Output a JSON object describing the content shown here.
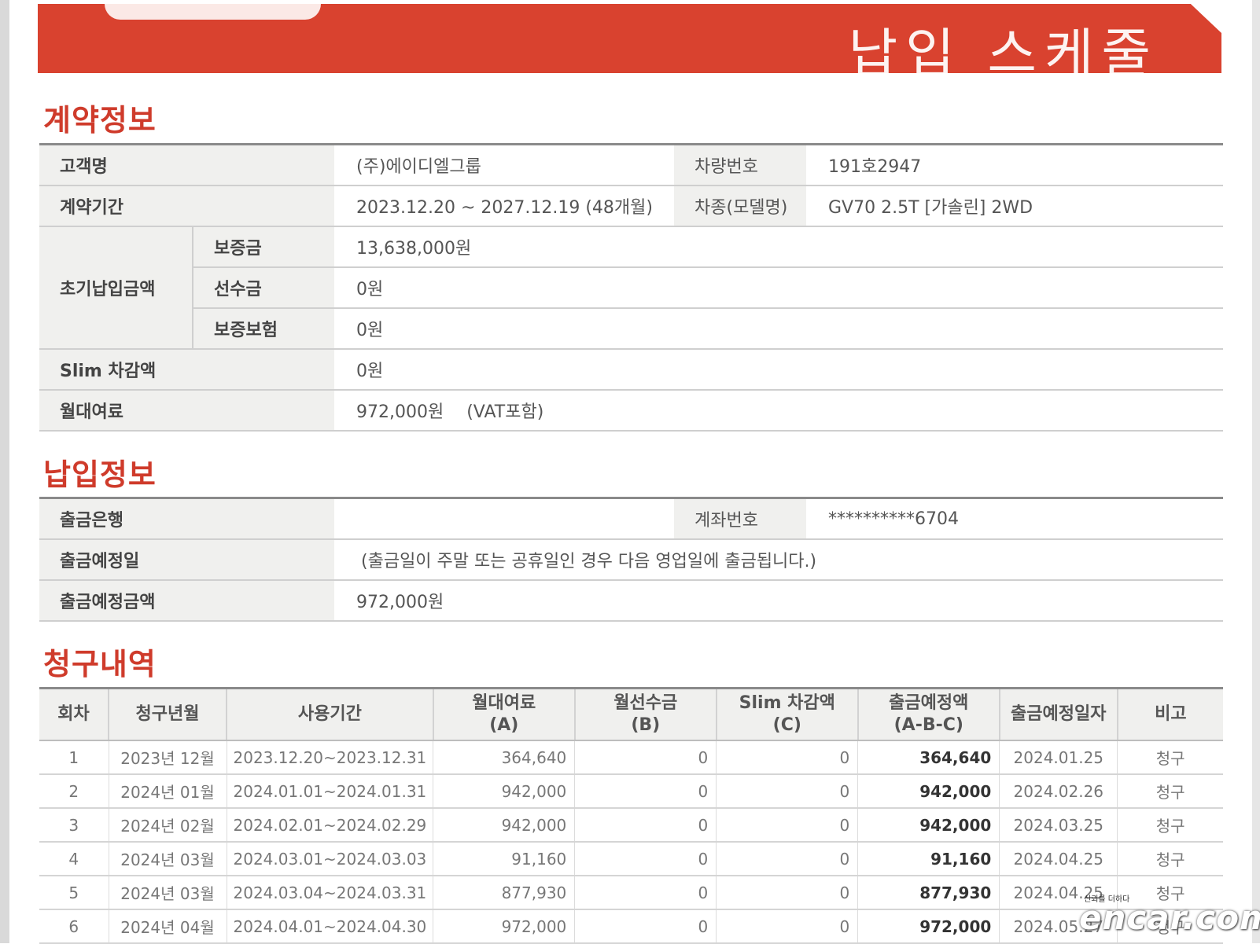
{
  "header": {
    "title": "납입 스케줄"
  },
  "contract": {
    "section_title": "계약정보",
    "customer_label": "고객명",
    "customer_value": "(주)에이디엘그룹",
    "plate_label": "차량번호",
    "plate_value": "191호2947",
    "period_label": "계약기간",
    "period_value": "2023.12.20 ~ 2027.12.19 (48개월)",
    "model_label": "차종(모델명)",
    "model_value": "GV70 2.5T [가솔린] 2WD",
    "initial_label": "초기납입금액",
    "deposit_label": "보증금",
    "deposit_value": "13,638,000원",
    "advance_label": "선수금",
    "advance_value": "0원",
    "insurance_label": "보증보험",
    "insurance_value": "0원",
    "slim_label": "Slim 차감액",
    "slim_value": "0원",
    "monthly_label": "월대여료",
    "monthly_value": "972,000원",
    "monthly_vat": "(VAT포함)"
  },
  "payment": {
    "section_title": "납입정보",
    "bank_label": "출금은행",
    "bank_value": "",
    "account_label": "계좌번호",
    "account_value": "**********6704",
    "date_label": "출금예정일",
    "date_value": "(출금일이 주말 또는 공휴일인 경우 다음 영업일에 출금됩니다.)",
    "amount_label": "출금예정금액",
    "amount_value": "972,000원"
  },
  "billing": {
    "section_title": "청구내역",
    "headers": {
      "round": "회차",
      "bill_month": "청구년월",
      "usage_period": "사용기간",
      "rent_line1": "월대여료",
      "rent_line2": "(A)",
      "prepay_line1": "월선수금",
      "prepay_line2": "(B)",
      "slim_line1": "Slim 차감액",
      "slim_line2": "(C)",
      "amount_line1": "출금예정액",
      "amount_line2": "(A-B-C)",
      "due_date": "출금예정일자",
      "note": "비고"
    },
    "rows": [
      {
        "round": "1",
        "month": "2023년 12월",
        "period": "2023.12.20~2023.12.31",
        "rent": "364,640",
        "prepay": "0",
        "slim": "0",
        "amount": "364,640",
        "due": "2024.01.25",
        "note": "청구"
      },
      {
        "round": "2",
        "month": "2024년 01월",
        "period": "2024.01.01~2024.01.31",
        "rent": "942,000",
        "prepay": "0",
        "slim": "0",
        "amount": "942,000",
        "due": "2024.02.26",
        "note": "청구"
      },
      {
        "round": "3",
        "month": "2024년 02월",
        "period": "2024.02.01~2024.02.29",
        "rent": "942,000",
        "prepay": "0",
        "slim": "0",
        "amount": "942,000",
        "due": "2024.03.25",
        "note": "청구"
      },
      {
        "round": "4",
        "month": "2024년 03월",
        "period": "2024.03.01~2024.03.03",
        "rent": "91,160",
        "prepay": "0",
        "slim": "0",
        "amount": "91,160",
        "due": "2024.04.25",
        "note": "청구"
      },
      {
        "round": "5",
        "month": "2024년 03월",
        "period": "2024.03.04~2024.03.31",
        "rent": "877,930",
        "prepay": "0",
        "slim": "0",
        "amount": "877,930",
        "due": "2024.04.25",
        "note": "청구"
      },
      {
        "round": "6",
        "month": "2024년 04월",
        "period": "2024.04.01~2024.04.30",
        "rent": "972,000",
        "prepay": "0",
        "slim": "0",
        "amount": "972,000",
        "due": "2024.05.27",
        "note": "청구"
      }
    ]
  },
  "watermark": {
    "tagline": "신뢰를 더하다",
    "brand": "encar.com"
  }
}
